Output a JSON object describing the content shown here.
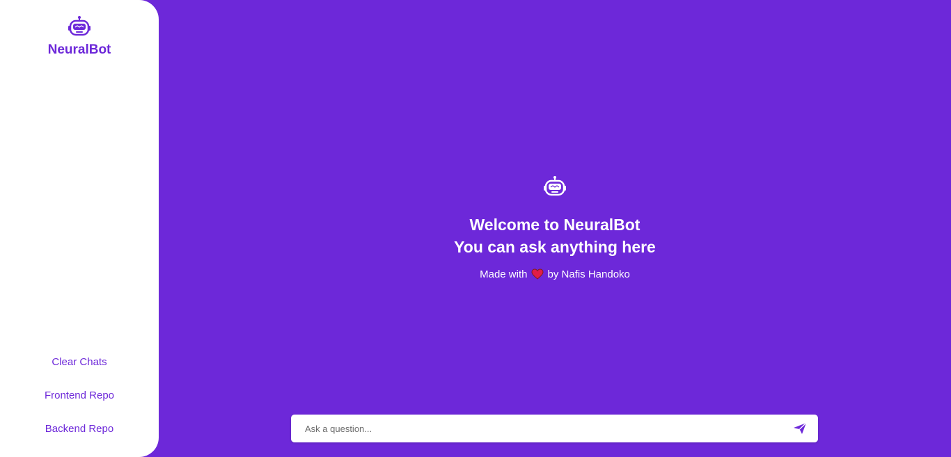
{
  "sidebar": {
    "brand_name": "NeuralBot",
    "brand_icon": "robot-icon",
    "links": {
      "clear_chats": "Clear Chats",
      "frontend_repo": "Frontend Repo",
      "backend_repo": "Backend Repo"
    }
  },
  "main": {
    "welcome_icon": "robot-icon",
    "welcome_line1": "Welcome to NeuralBot",
    "welcome_line2": "You can ask anything here",
    "credit_prefix": "Made with",
    "credit_icon": "heart-icon",
    "credit_suffix": "by Nafis Handoko"
  },
  "input": {
    "placeholder": "Ask a question...",
    "value": "",
    "send_icon": "send-icon"
  },
  "colors": {
    "accent": "#6d28d9",
    "background": "#6d28d9",
    "sidebar_bg": "#ffffff",
    "heart": "#e11d48"
  }
}
